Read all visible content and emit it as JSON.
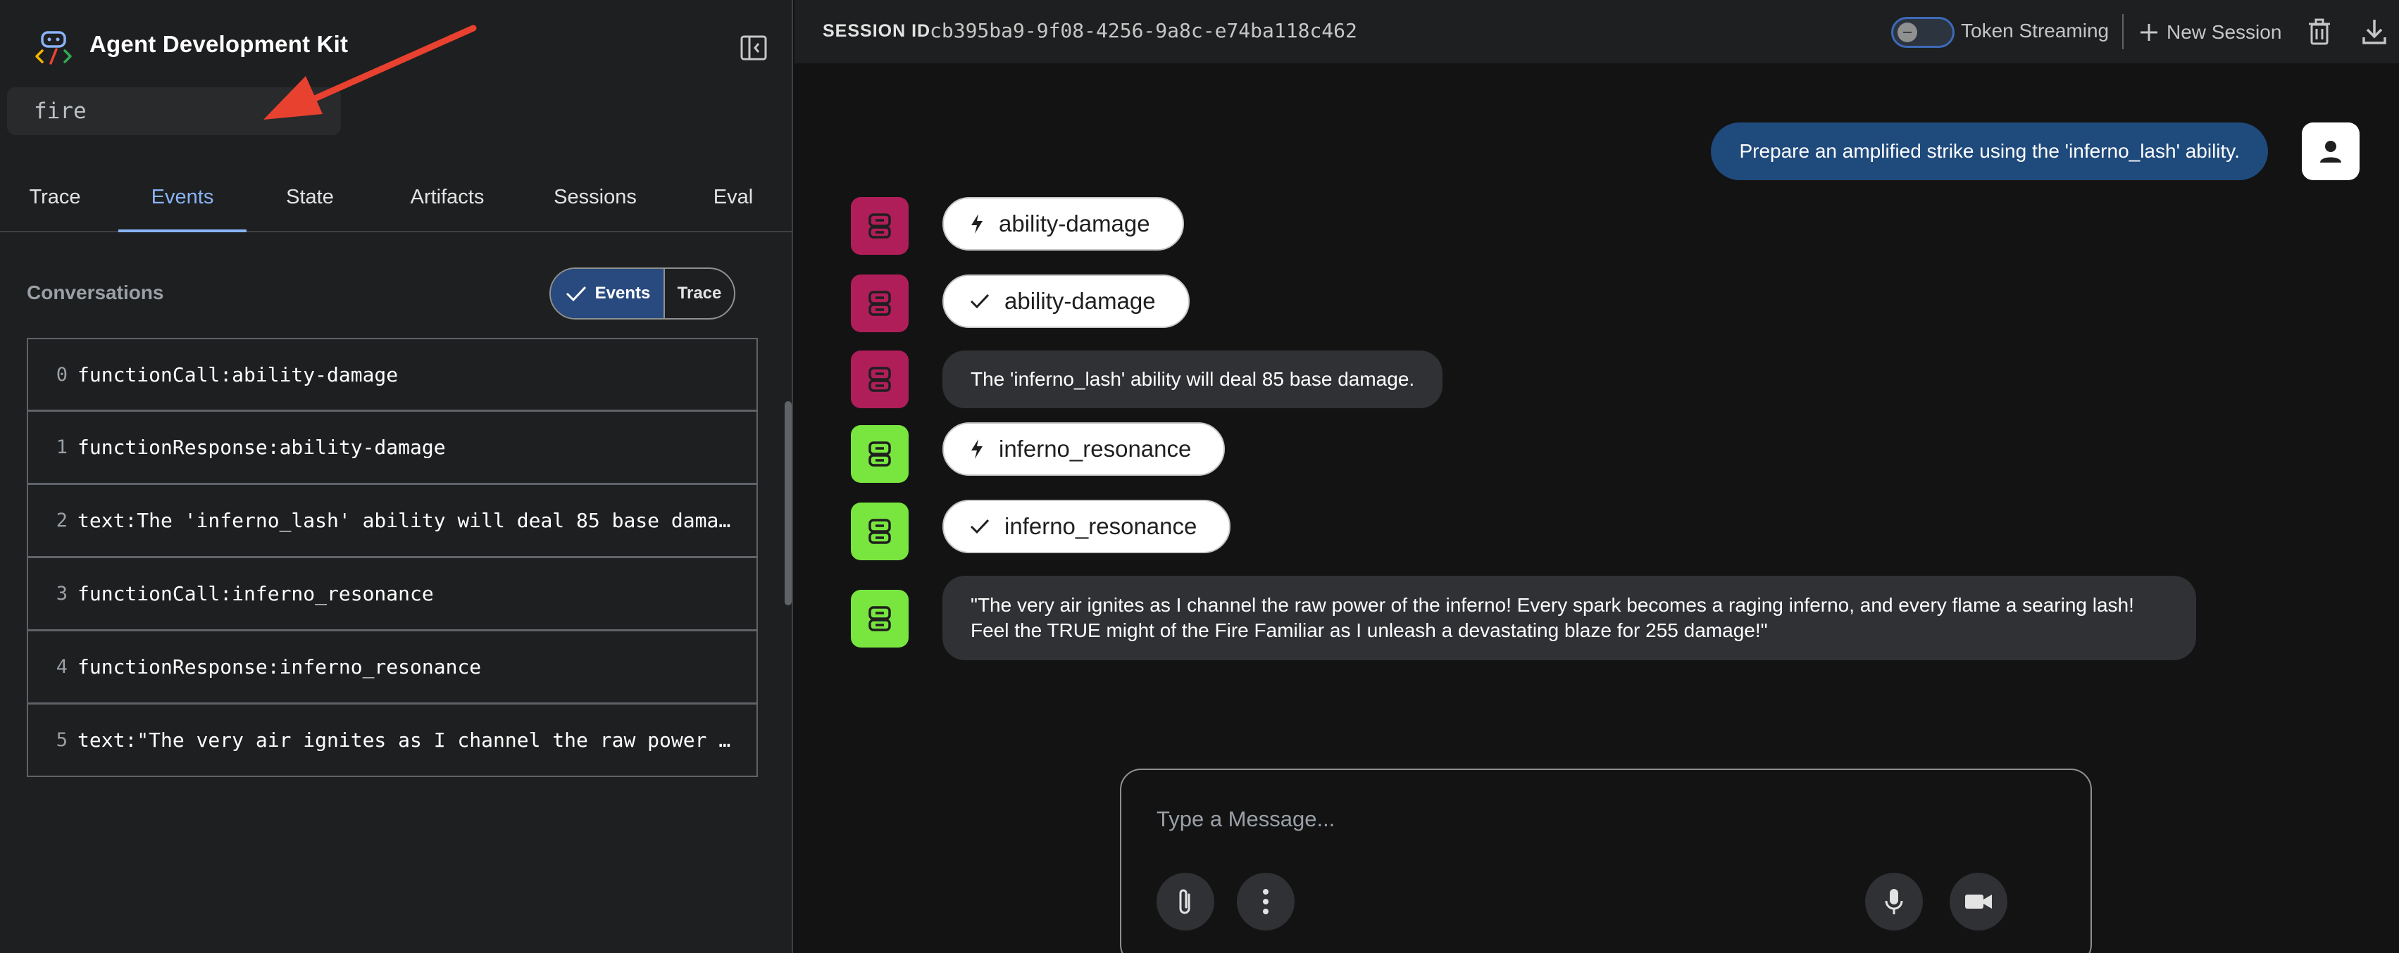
{
  "app": {
    "title": "Agent Development Kit"
  },
  "search": {
    "value": "fire"
  },
  "tabs": [
    {
      "label": "Trace"
    },
    {
      "label": "Events"
    },
    {
      "label": "State"
    },
    {
      "label": "Artifacts"
    },
    {
      "label": "Sessions"
    },
    {
      "label": "Eval"
    }
  ],
  "active_tab": "Events",
  "conversations": {
    "label": "Conversations",
    "toggle": {
      "events_label": "Events",
      "trace_label": "Trace",
      "selected": "Events"
    },
    "events": [
      {
        "index": "0",
        "text": "functionCall:ability-damage"
      },
      {
        "index": "1",
        "text": "functionResponse:ability-damage"
      },
      {
        "index": "2",
        "text": "text:The 'inferno_lash' ability will deal 85 base damage."
      },
      {
        "index": "3",
        "text": "functionCall:inferno_resonance"
      },
      {
        "index": "4",
        "text": "functionResponse:inferno_resonance"
      },
      {
        "index": "5",
        "text": "text:\"The very air ignites as I channel the raw power of the inferno! Every spark becomes a raging inferno, and every flame a searing lash!\""
      }
    ]
  },
  "header": {
    "session_label": "SESSION ID",
    "session_id": "cb395ba9-9f08-4256-9a8c-e74ba118c462",
    "streaming_label": "Token Streaming",
    "streaming_enabled": false,
    "new_session_label": "New Session"
  },
  "chat": {
    "user_message": "Prepare an amplified strike using the 'inferno_lash' ability.",
    "items": [
      {
        "kind": "call",
        "agent_color": "#b01e5a",
        "label": "ability-damage",
        "icon": "bolt-icon"
      },
      {
        "kind": "response",
        "agent_color": "#b01e5a",
        "label": "ability-damage",
        "icon": "check-icon"
      },
      {
        "kind": "text",
        "agent_color": "#b01e5a",
        "text": "The 'inferno_lash' ability will deal 85 base damage."
      },
      {
        "kind": "call",
        "agent_color": "#79e63f",
        "label": "inferno_resonance",
        "icon": "bolt-icon"
      },
      {
        "kind": "response",
        "agent_color": "#79e63f",
        "label": "inferno_resonance",
        "icon": "check-icon"
      },
      {
        "kind": "text",
        "agent_color": "#79e63f",
        "line1": "\"The very air ignites as I channel the raw power of the inferno! Every spark becomes a raging inferno, and every flame a searing lash!",
        "line2": "Feel the TRUE might of the Fire Familiar as I unleash a devastating blaze for 255 damage!\""
      }
    ]
  },
  "composer": {
    "placeholder": "Type a Message..."
  },
  "colors": {
    "accent": "#8ab4f8",
    "user_bubble": "#1f4a7c",
    "agent_pink": "#b01e5a",
    "agent_green": "#79e63f",
    "annotation_arrow": "#e8412f"
  }
}
